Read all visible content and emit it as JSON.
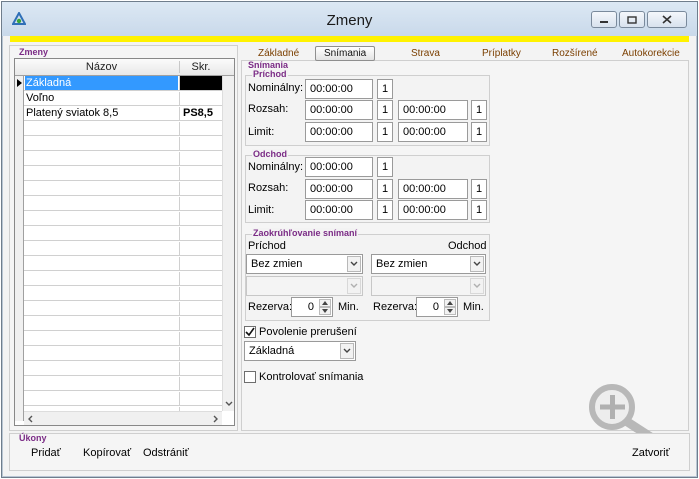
{
  "window": {
    "title": "Zmeny"
  },
  "left_panel": {
    "group_label": "Zmeny",
    "columns": [
      "Názov",
      "Skr."
    ],
    "rows": [
      {
        "name": "Základná",
        "code": "",
        "selected": true
      },
      {
        "name": "Voľno",
        "code": ""
      },
      {
        "name": "Platený sviatok 8,5",
        "code": "PS8,5"
      }
    ]
  },
  "tabs": [
    "Základné",
    "Snímania",
    "Strava",
    "Príplatky",
    "Rozšírené",
    "Autokorekcie"
  ],
  "active_tab": "Snímania",
  "snimania": {
    "section_label": "Snímania",
    "prichod": {
      "title": "Príchod",
      "nominal_label": "Nominálny:",
      "nominal": {
        "time": "00:00:00",
        "day": "1"
      },
      "rozsah_label": "Rozsah:",
      "rozsah": {
        "from": "00:00:00",
        "from_day": "1",
        "to": "00:00:00",
        "to_day": "1"
      },
      "limit_label": "Limit:",
      "limit": {
        "from": "00:00:00",
        "from_day": "1",
        "to": "00:00:00",
        "to_day": "1"
      }
    },
    "odchod": {
      "title": "Odchod",
      "nominal_label": "Nominálny:",
      "nominal": {
        "time": "00:00:00",
        "day": "1"
      },
      "rozsah_label": "Rozsah:",
      "rozsah": {
        "from": "00:00:00",
        "from_day": "1",
        "to": "00:00:00",
        "to_day": "1"
      },
      "limit_label": "Limit:",
      "limit": {
        "from": "00:00:00",
        "from_day": "1",
        "to": "00:00:00",
        "to_day": "1"
      }
    },
    "zaokruhlovanie": {
      "title": "Zaokrúhľovanie snímaní",
      "prichod_label": "Príchod",
      "odchod_label": "Odchod",
      "prichod_select": "Bez zmien",
      "odchod_select": "Bez zmien",
      "rezerva_label": "Rezerva:",
      "prichod_rezerva": "0",
      "odchod_rezerva": "0",
      "min_label": "Min."
    },
    "povolenie_prerusenia": {
      "label": "Povolenie prerušení",
      "checked": true,
      "select": "Základná"
    },
    "kontrolovat_snimania": {
      "label": "Kontrolovať snímania",
      "checked": false
    }
  },
  "ukony": {
    "label": "Úkony",
    "buttons": {
      "add": "Pridať",
      "copy": "Kopírovať",
      "delete": "Odstrániť",
      "close": "Zatvoriť"
    }
  },
  "colors": {
    "accent_bar": "#fff200",
    "group_label": "#7b2c86",
    "selection": "#3399ff",
    "tab_text": "#7b3f00"
  }
}
